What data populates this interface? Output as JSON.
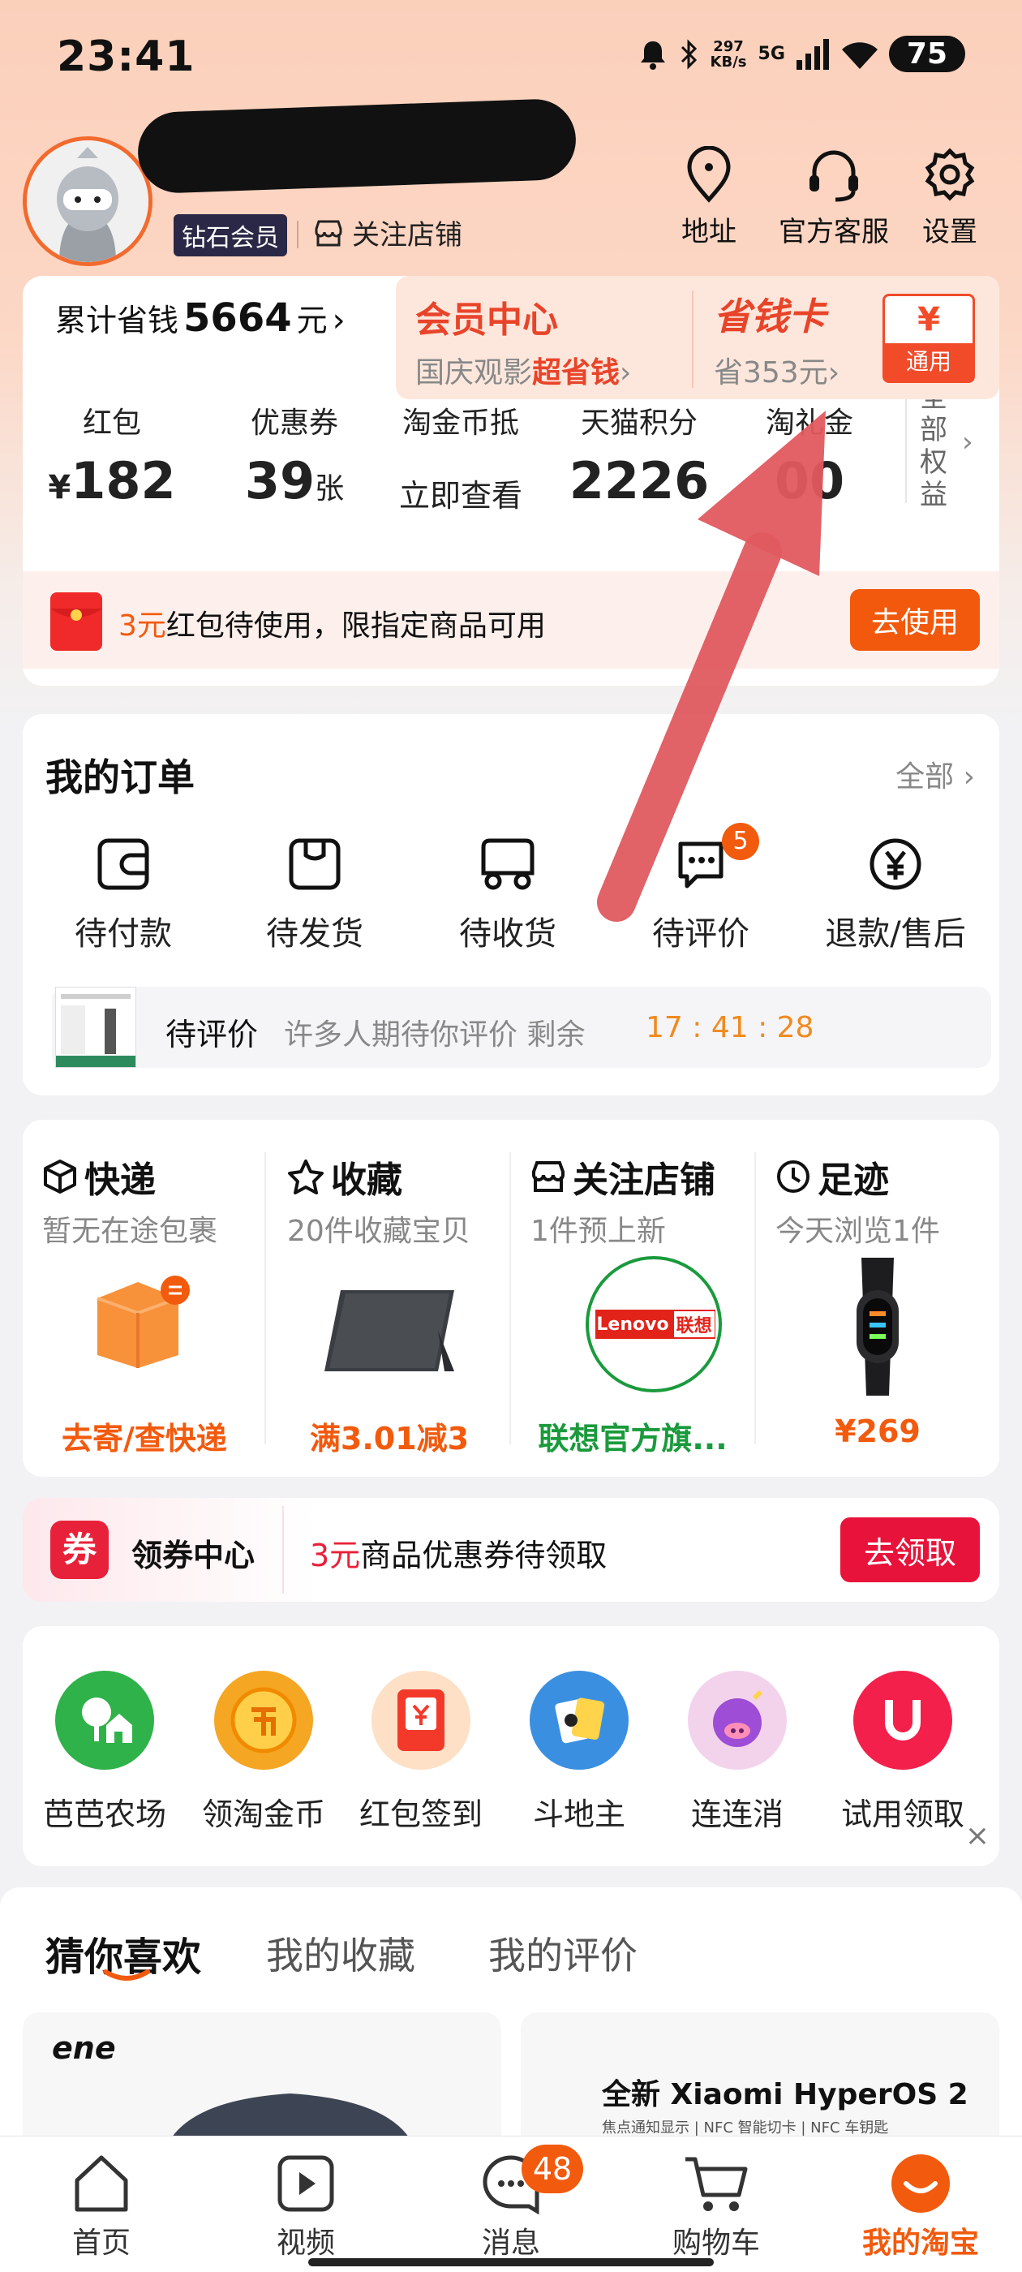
{
  "status_bar": {
    "time": "23:41",
    "net_speed": "297",
    "net_unit": "KB/s",
    "network": "5G",
    "battery": "75"
  },
  "profile": {
    "member_level": "钻石会员",
    "follow_store": "关注店铺"
  },
  "top_nav": [
    {
      "label": "地址",
      "icon": "location-pin-icon"
    },
    {
      "label": "官方客服",
      "icon": "headset-icon"
    },
    {
      "label": "设置",
      "icon": "gear-icon"
    }
  ],
  "savings": {
    "prefix": "累计省钱",
    "amount": "5664",
    "suffix": "元",
    "arrow": "›"
  },
  "member_center": {
    "title": "会员中心",
    "subtitle_prefix": "国庆观影",
    "subtitle_highlight": "超省钱",
    "subtitle_arrow": "›"
  },
  "save_card": {
    "title": "省钱卡",
    "subtitle": "省353元",
    "subtitle_arrow": "›",
    "badge_symbol": "¥",
    "badge_label": "通用"
  },
  "benefits": [
    {
      "label": "红包",
      "prefix": "¥",
      "value": "182",
      "unit": ""
    },
    {
      "label": "优惠券",
      "prefix": "",
      "value": "39",
      "unit": "张"
    },
    {
      "label": "淘金币抵",
      "prefix": "",
      "value": "立即查看",
      "unit": ""
    },
    {
      "label": "天猫积分",
      "prefix": "",
      "value": "2226",
      "unit": ""
    },
    {
      "label": "淘礼金",
      "prefix": "",
      "value": "00",
      "unit": ""
    }
  ],
  "all_benefits": {
    "label": "全部权益",
    "arrow": "›"
  },
  "redpacket_notice": {
    "amount": "3元",
    "text": "红包待使用，限指定商品可用",
    "button": "去使用"
  },
  "orders": {
    "title": "我的订单",
    "all": "全部",
    "all_arrow": "›",
    "items": [
      {
        "label": "待付款",
        "badge": ""
      },
      {
        "label": "待发货",
        "badge": ""
      },
      {
        "label": "待收货",
        "badge": ""
      },
      {
        "label": "待评价",
        "badge": "5"
      },
      {
        "label": "退款/售后",
        "badge": ""
      }
    ],
    "review_banner": {
      "title": "待评价",
      "text": "许多人期待你评价 剩余",
      "countdown": "17 : 41 : 28"
    }
  },
  "quick_sections": [
    {
      "title": "快递",
      "subtitle": "暂无在途包裹",
      "bottom": "去寄/查快递",
      "color": "#f25a0d",
      "icon": "box-icon"
    },
    {
      "title": "收藏",
      "subtitle": "20件收藏宝贝",
      "bottom": "满3.01减3",
      "color": "#f25a0d",
      "icon": "star-icon"
    },
    {
      "title": "关注店铺",
      "subtitle": "1件预上新",
      "bottom": "联想官方旗...",
      "color": "#1a9a3c",
      "icon": "store-icon"
    },
    {
      "title": "足迹",
      "subtitle": "今天浏览1件",
      "bottom": "¥269",
      "color": "#f25a0d",
      "icon": "clock-icon"
    }
  ],
  "lenovo_logo": {
    "latin": "Lenovo",
    "cjk": "联想"
  },
  "coupon_center": {
    "icon_text": "券",
    "title": "领券中心",
    "amount": "3元",
    "text": "商品优惠券待领取",
    "button": "去领取"
  },
  "games": [
    {
      "label": "芭芭农场",
      "color": "#2fb24a"
    },
    {
      "label": "领淘金币",
      "color": "#f5a623"
    },
    {
      "label": "红包签到",
      "color": "#fde0c6"
    },
    {
      "label": "斗地主",
      "color": "#3b8fe0"
    },
    {
      "label": "连连消",
      "color": "#f3d3ec"
    },
    {
      "label": "试用领取",
      "color": "#f2204a"
    }
  ],
  "games_close": "×",
  "feed_tabs": [
    {
      "label": "猜你喜欢"
    },
    {
      "label": "我的收藏"
    },
    {
      "label": "我的评价"
    }
  ],
  "feed_left": {
    "brand": "ene"
  },
  "feed_right": {
    "title_prefix": "全新 ",
    "title_main": "Xiaomi HyperOS 2",
    "features": "焦点通知显示 | NFC 智能切卡 | NFC 车钥匙"
  },
  "tabbar": [
    {
      "label": "首页",
      "badge": ""
    },
    {
      "label": "视频",
      "badge": ""
    },
    {
      "label": "消息",
      "badge": "48"
    },
    {
      "label": "购物车",
      "badge": ""
    },
    {
      "label": "我的淘宝",
      "badge": ""
    }
  ],
  "colors": {
    "accent": "#f25a0d",
    "red": "#e8213a",
    "green": "#1a9a3c",
    "timer": "#f08a1f"
  }
}
